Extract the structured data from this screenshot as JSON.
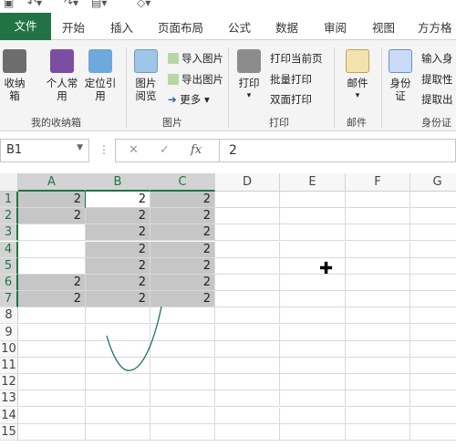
{
  "quick_access": {
    "undo_icon": "undo-icon",
    "redo_icon": "redo-icon"
  },
  "tabs": [
    "文件",
    "开始",
    "插入",
    "页面布局",
    "公式",
    "数据",
    "审阅",
    "视图",
    "方方格"
  ],
  "ribbon": {
    "groups": {
      "collection": {
        "label": "我的收纳箱",
        "buttons": [
          "收纳箱",
          "个人常用",
          "定位引用"
        ]
      },
      "picture": {
        "label": "图片",
        "preview": "图片阅览",
        "small": [
          "导入图片",
          "导出图片",
          "更多"
        ]
      },
      "print": {
        "label": "打印",
        "big": "打印",
        "small": [
          "打印当前页",
          "批量打印",
          "双面打印"
        ]
      },
      "mail": {
        "label": "邮件",
        "big": "邮件"
      },
      "idcard": {
        "label": "身份证",
        "big": "身份证",
        "small": [
          "输入身",
          "提取性",
          "提取出"
        ]
      }
    }
  },
  "formula_bar": {
    "name_box": "B1",
    "fx_label": "fx",
    "value": "2"
  },
  "grid": {
    "columns": [
      "A",
      "B",
      "C",
      "D",
      "E",
      "F",
      "G"
    ],
    "rows": [
      "1",
      "2",
      "3",
      "4",
      "5",
      "6",
      "7",
      "8",
      "9",
      "10",
      "11",
      "12",
      "13",
      "14",
      "15"
    ],
    "cells": {
      "A1": "2",
      "B1": "2",
      "C1": "2",
      "A2": "2",
      "B2": "2",
      "C2": "2",
      "B3": "2",
      "C3": "2",
      "B4": "2",
      "C4": "2",
      "B5": "2",
      "C5": "2",
      "A6": "2",
      "B6": "2",
      "C6": "2",
      "A7": "2",
      "B7": "2",
      "C7": "2"
    }
  },
  "colors": {
    "accent": "#217346",
    "selection": "#c6c6c6"
  }
}
